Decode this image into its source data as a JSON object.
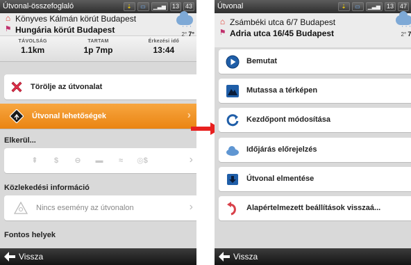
{
  "left": {
    "title": "Útvonal-összefoglaló",
    "status": {
      "clock_h": "13",
      "clock_m": "43"
    },
    "from": "Könyves Kálmán körút Budapest",
    "to": "Hungária körút Budapest",
    "weather": {
      "temp_min": "2°",
      "temp_max": "7°"
    },
    "stats": [
      {
        "label": "TÁVOLSÁG",
        "value": "1.1km"
      },
      {
        "label": "TARTAM",
        "value": "1p 7mp"
      },
      {
        "label": "Érkezési idő",
        "value": "13:44"
      }
    ],
    "delete_route": "Törölje az útvonalat",
    "route_options": "Útvonal lehetőségek",
    "avoid_header": "Elkerül...",
    "traffic_header": "Közlekedési információ",
    "no_events": "Nincs esemény az útvonalon",
    "places_header": "Fontos helyek",
    "back": "Vissza"
  },
  "right": {
    "title": "Útvonal",
    "status": {
      "clock_h": "13",
      "clock_m": "47"
    },
    "from": "Zsámbéki utca 6/7 Budapest",
    "to": "Adria utca 16/45 Budapest",
    "weather": {
      "temp_min": "2°",
      "temp_max": "7°"
    },
    "items": [
      "Bemutat",
      "Mutassa a térképen",
      "Kezdőpont módosítása",
      "Időjárás előrejelzés",
      "Útvonal elmentése",
      "Alapértelmezett beállítások visszaá..."
    ],
    "back": "Vissza"
  },
  "colors": {
    "accent_orange": "#f0911f",
    "arrow_red": "#e8201f",
    "icon_blue": "#1f5ea8"
  },
  "icons": {
    "avoid": [
      "highway-icon",
      "toll-icon",
      "ferry-icon",
      "car-train-icon",
      "unpaved-icon",
      "permit-icon"
    ]
  }
}
